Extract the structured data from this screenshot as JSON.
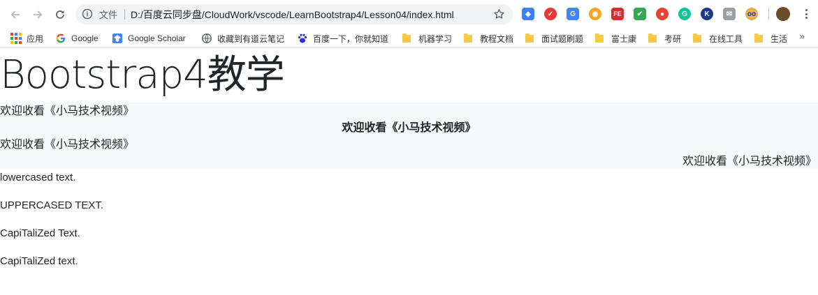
{
  "browser": {
    "address_bar": {
      "label": "文件",
      "url": "D:/百度云同步盘/CloudWork/vscode/LearnBootstrap4/Lesson04/index.html"
    },
    "extension_icons": [
      "bookmark-ext-icon",
      "todo-check-icon",
      "translate-icon",
      "weibo-icon",
      "fe-helper-icon",
      "shield-icon",
      "location-pin-icon",
      "grammarly-icon",
      "k-icon",
      "mail-blocked-icon",
      "owl-icon"
    ],
    "bookmarks": [
      {
        "label": "应用",
        "icon": "apps-grid-icon"
      },
      {
        "label": "Google",
        "icon": "google-icon"
      },
      {
        "label": "Google Scholar",
        "icon": "scholar-icon"
      },
      {
        "label": "收藏到有道云笔记",
        "icon": "globe-icon"
      },
      {
        "label": "百度一下，你就知道",
        "icon": "baidu-icon"
      },
      {
        "label": "机器学习",
        "icon": "folder-icon"
      },
      {
        "label": "教程文档",
        "icon": "folder-icon"
      },
      {
        "label": "面试题刷题",
        "icon": "folder-icon"
      },
      {
        "label": "富士康",
        "icon": "folder-icon"
      },
      {
        "label": "考研",
        "icon": "folder-icon"
      },
      {
        "label": "在线工具",
        "icon": "folder-icon"
      },
      {
        "label": "生活",
        "icon": "folder-icon"
      }
    ],
    "overflow": "»",
    "colors": {
      "folder": "#f6c84c",
      "omnibox_bg": "#f1f3f4",
      "chrome_icon": "#5f6368"
    }
  },
  "page": {
    "heading": "Bootstrap4教学",
    "aligned_lines": [
      "欢迎收看《小马技术视频》",
      "欢迎收看《小马技术视频》",
      "欢迎收看《小马技术视频》",
      "欢迎收看《小马技术视频》"
    ],
    "transform_lines": [
      "lowercased text.",
      "UPPERCASED TEXT.",
      "CapiTaliZed Text.",
      "CapiTaliZed text."
    ],
    "colors": {
      "text": "#212529",
      "light_bg": "#f8f9fa"
    }
  }
}
